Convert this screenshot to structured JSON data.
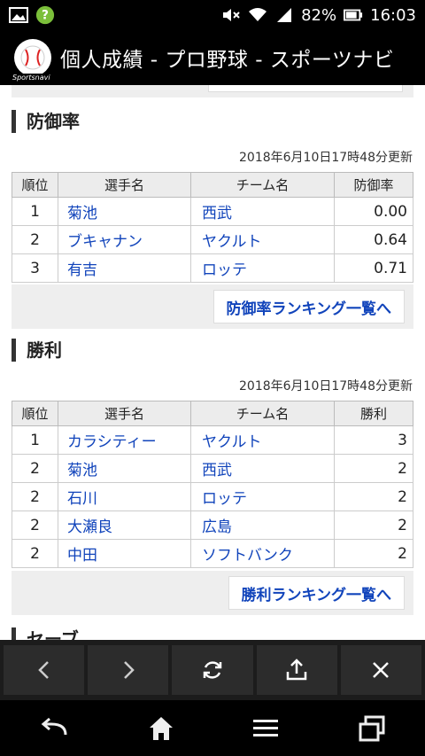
{
  "status": {
    "battery": "82%",
    "time": "16:03"
  },
  "title": "個人成績 - プロ野球 - スポーツナビ",
  "logo_text": "Sportsnavi",
  "era": {
    "heading": "防御率",
    "updated": "2018年6月10日17時48分更新",
    "columns": [
      "順位",
      "選手名",
      "チーム名",
      "防御率"
    ],
    "rows": [
      {
        "rank": "1",
        "player": "菊池",
        "team": "西武",
        "value": "0.00"
      },
      {
        "rank": "2",
        "player": "ブキャナン",
        "team": "ヤクルト",
        "value": "0.64"
      },
      {
        "rank": "3",
        "player": "有吉",
        "team": "ロッテ",
        "value": "0.71"
      }
    ],
    "more": "防御率ランキング一覧へ"
  },
  "wins": {
    "heading": "勝利",
    "updated": "2018年6月10日17時48分更新",
    "columns": [
      "順位",
      "選手名",
      "チーム名",
      "勝利"
    ],
    "rows": [
      {
        "rank": "1",
        "player": "カラシティー",
        "team": "ヤクルト",
        "value": "3"
      },
      {
        "rank": "2",
        "player": "菊池",
        "team": "西武",
        "value": "2"
      },
      {
        "rank": "2",
        "player": "石川",
        "team": "ロッテ",
        "value": "2"
      },
      {
        "rank": "2",
        "player": "大瀬良",
        "team": "広島",
        "value": "2"
      },
      {
        "rank": "2",
        "player": "中田",
        "team": "ソフトバンク",
        "value": "2"
      }
    ],
    "more": "勝利ランキング一覧へ"
  },
  "next_heading": "セーブ",
  "toolbar": [
    "back-icon",
    "forward-icon",
    "reload-icon",
    "share-icon",
    "close-icon"
  ],
  "navbar": [
    "back-icon",
    "home-icon",
    "menu-icon",
    "recents-icon"
  ]
}
